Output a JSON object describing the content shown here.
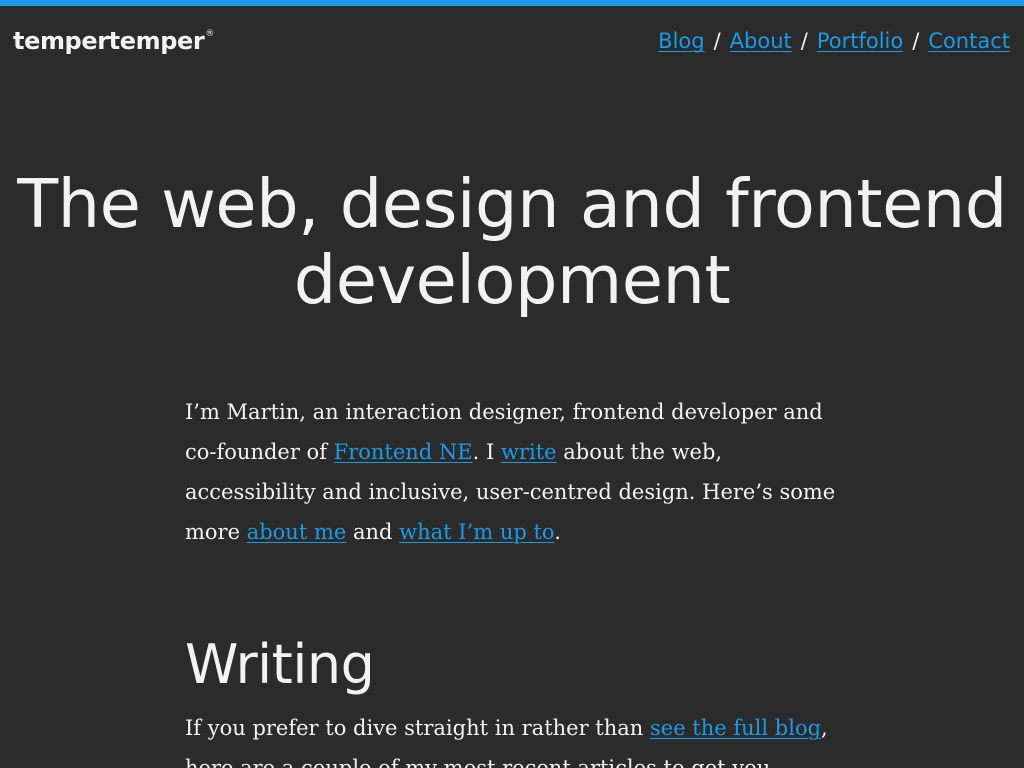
{
  "site": {
    "logo_text": "tempertemper",
    "logo_mark": "®",
    "accent_color": "#1a9be8",
    "background_color": "#2b2b2b"
  },
  "nav": {
    "items": [
      {
        "label": "Blog"
      },
      {
        "label": "About"
      },
      {
        "label": "Portfolio"
      },
      {
        "label": "Contact"
      }
    ],
    "separator": "/"
  },
  "hero": {
    "title": "The web, design and frontend development"
  },
  "intro": {
    "text_1": "I’m Martin, an interaction designer, frontend developer and co-founder of ",
    "link_frontend_ne": "Frontend NE",
    "text_2": ". I ",
    "link_write": "write",
    "text_3": " about the web, accessibility and inclusive, user-centred design. Here’s some more ",
    "link_about_me": "about me",
    "text_4": " and ",
    "link_up_to": "what I’m up to",
    "text_5": "."
  },
  "writing": {
    "heading": "Writing",
    "text_1": "If you prefer to dive straight in rather than ",
    "link_full_blog": "see the full blog",
    "text_2": ", here are a couple of my most recent articles to get you"
  }
}
